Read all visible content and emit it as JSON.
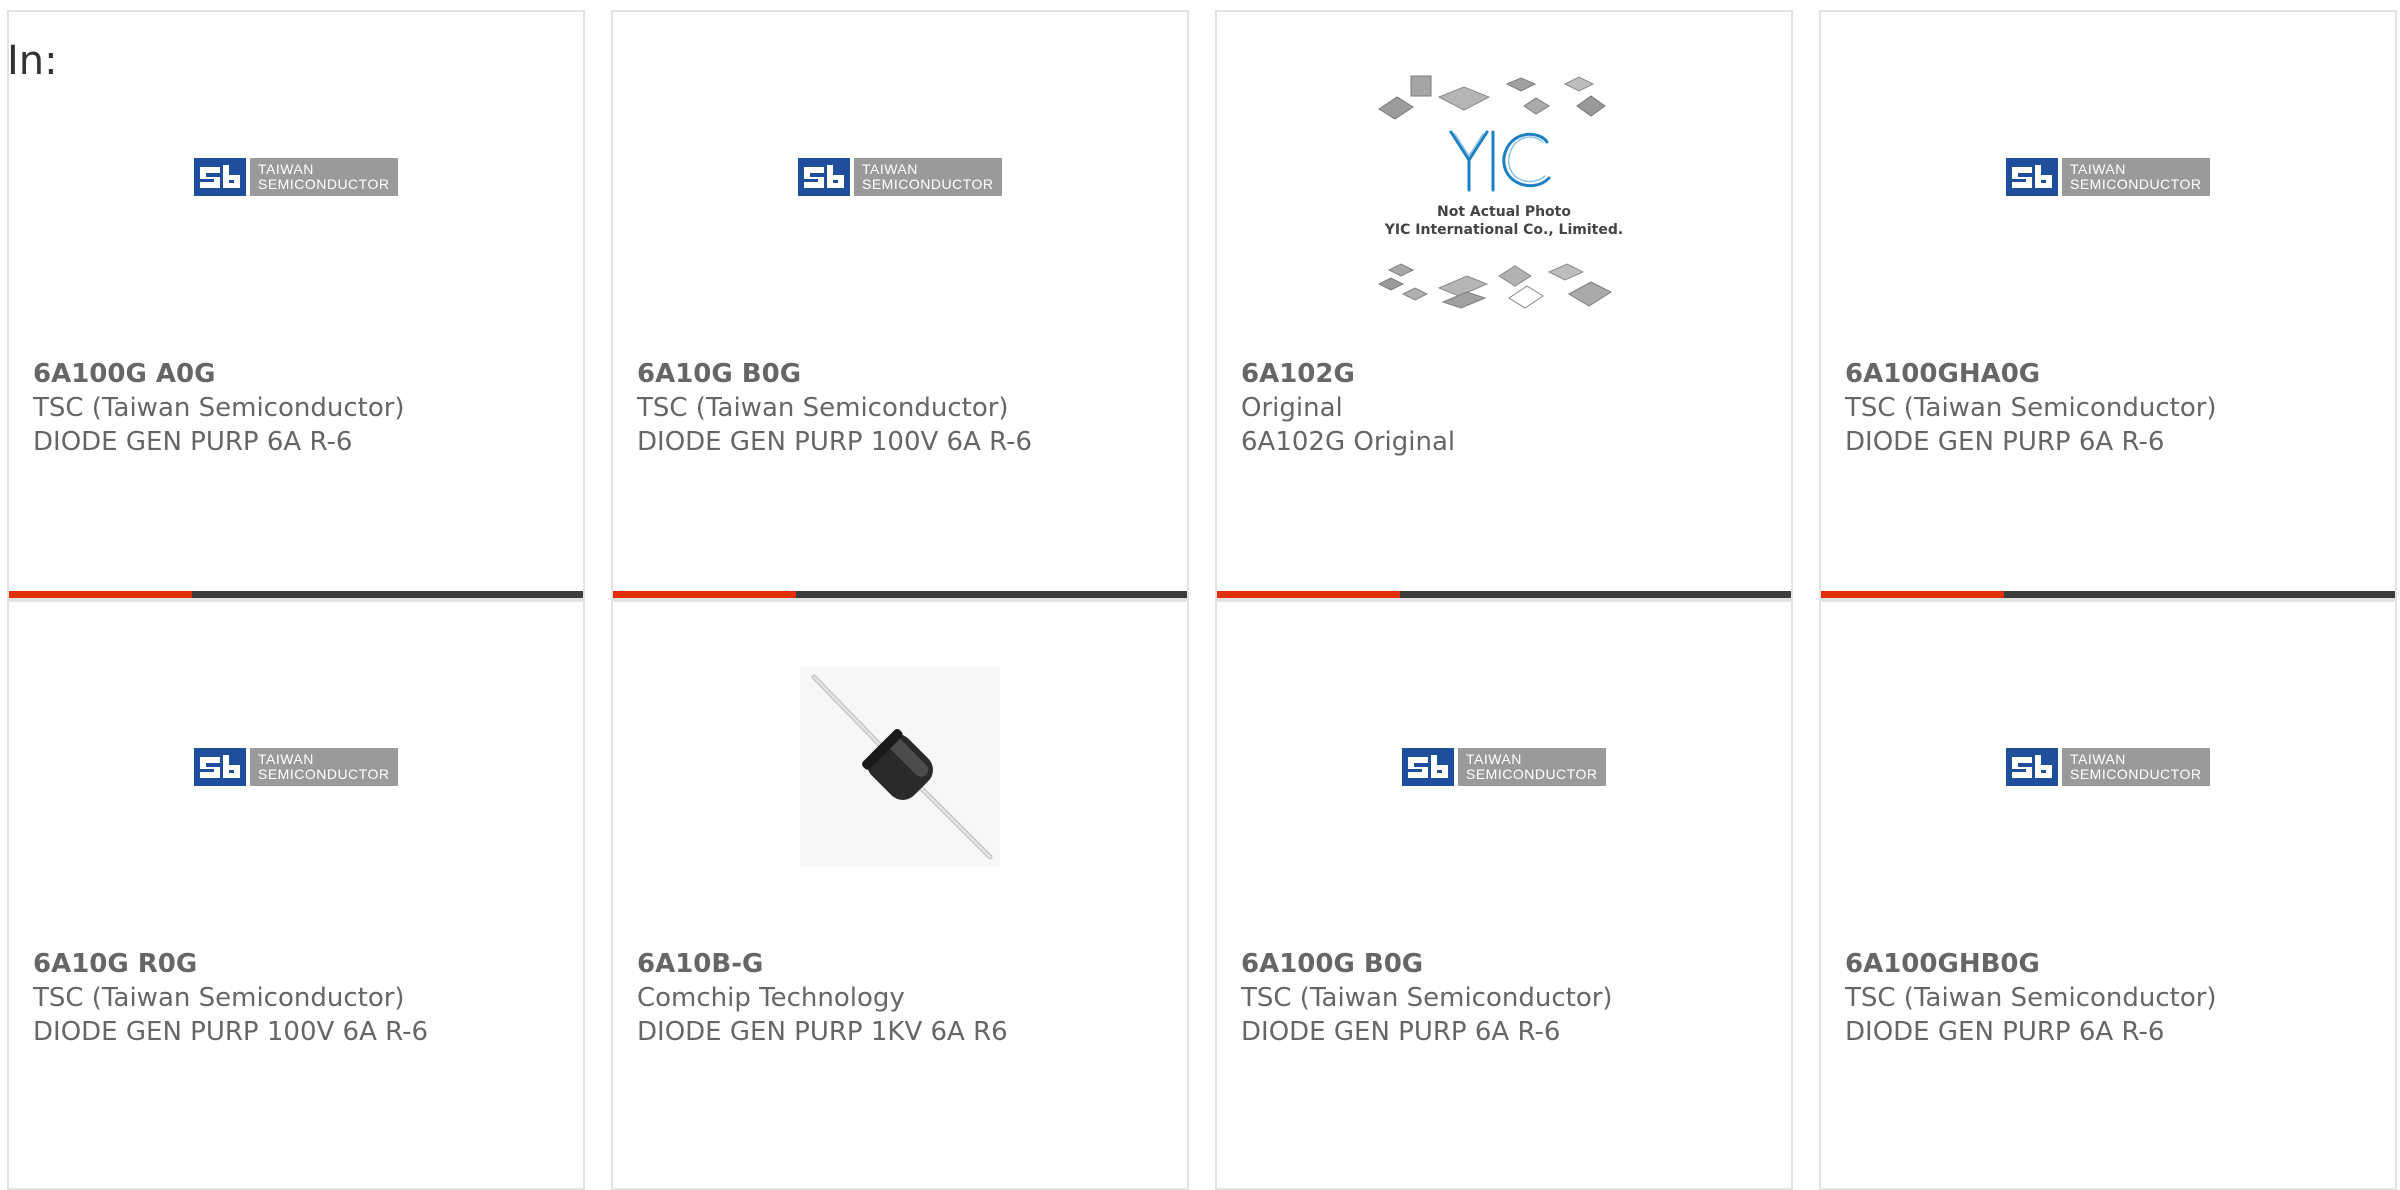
{
  "header": {
    "in_label": "In:"
  },
  "logos": {
    "tsc_line1": "TAIWAN",
    "tsc_line2": "SEMICONDUCTOR",
    "yic_caption1": "Not Actual Photo",
    "yic_caption2": "YIC International Co., Limited."
  },
  "colors": {
    "accent": "#e0300c",
    "bar": "#3c3c3c",
    "text": "#666666",
    "border": "#e3e3e3",
    "tsc_blue": "#1f4e9c"
  },
  "products": [
    {
      "part": "6A100G A0G",
      "manufacturer": "TSC (Taiwan Semiconductor)",
      "description": "DIODE GEN PURP 6A R-6",
      "image": "tsc-logo"
    },
    {
      "part": "6A10G B0G",
      "manufacturer": "TSC (Taiwan Semiconductor)",
      "description": "DIODE GEN PURP 100V 6A R-6",
      "image": "tsc-logo"
    },
    {
      "part": "6A102G",
      "manufacturer": "Original",
      "description": "6A102G Original",
      "image": "yic-placeholder"
    },
    {
      "part": "6A100GHA0G",
      "manufacturer": "TSC (Taiwan Semiconductor)",
      "description": "DIODE GEN PURP 6A R-6",
      "image": "tsc-logo"
    },
    {
      "part": "6A10G R0G",
      "manufacturer": "TSC (Taiwan Semiconductor)",
      "description": "DIODE GEN PURP 100V 6A R-6",
      "image": "tsc-logo"
    },
    {
      "part": "6A10B-G",
      "manufacturer": "Comchip Technology",
      "description": "DIODE GEN PURP 1KV 6A R6",
      "image": "diode-photo"
    },
    {
      "part": "6A100G B0G",
      "manufacturer": "TSC (Taiwan Semiconductor)",
      "description": "DIODE GEN PURP 6A R-6",
      "image": "tsc-logo"
    },
    {
      "part": "6A100GHB0G",
      "manufacturer": "TSC (Taiwan Semiconductor)",
      "description": "DIODE GEN PURP 6A R-6",
      "image": "tsc-logo"
    }
  ]
}
